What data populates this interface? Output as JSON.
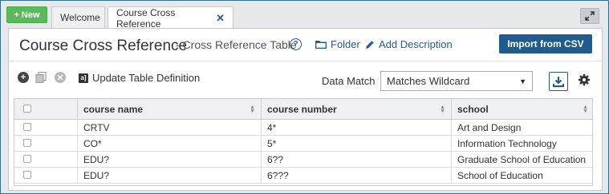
{
  "topbar": {
    "new_label": "+ New",
    "tabs": [
      {
        "label": "Welcome"
      },
      {
        "label": "Course Cross Reference",
        "close": "✕"
      }
    ]
  },
  "header": {
    "title": "Course Cross Reference",
    "subtitle": "- Cross Reference Table",
    "help": "?",
    "folder_label": "Folder",
    "add_description_label": "Add Description",
    "import_label": "Import from CSV"
  },
  "toolbar": {
    "update_label": "Update Table Definition",
    "data_match_label": "Data Match",
    "data_match_value": "Matches Wildcard"
  },
  "table": {
    "columns": [
      "course name",
      "course number",
      "school"
    ],
    "rows": [
      {
        "course_name": "CRTV",
        "course_number": "4*",
        "school": "Art and Design"
      },
      {
        "course_name": "CO*",
        "course_number": "5*",
        "school": "Information Technology"
      },
      {
        "course_name": "EDU?",
        "course_number": "6??",
        "school": "Graduate School of Education"
      },
      {
        "course_name": "EDU?",
        "course_number": "6???",
        "school": "School of Education"
      }
    ]
  },
  "icons": {
    "add": "plus-circle-icon",
    "copy": "copy-icon",
    "remove": "remove-circle-icon",
    "download": "download-icon",
    "settings": "gear-icon",
    "expand": "expand-icon"
  },
  "colors": {
    "accent": "#1e5c8e",
    "new_button": "#5cb85c"
  }
}
